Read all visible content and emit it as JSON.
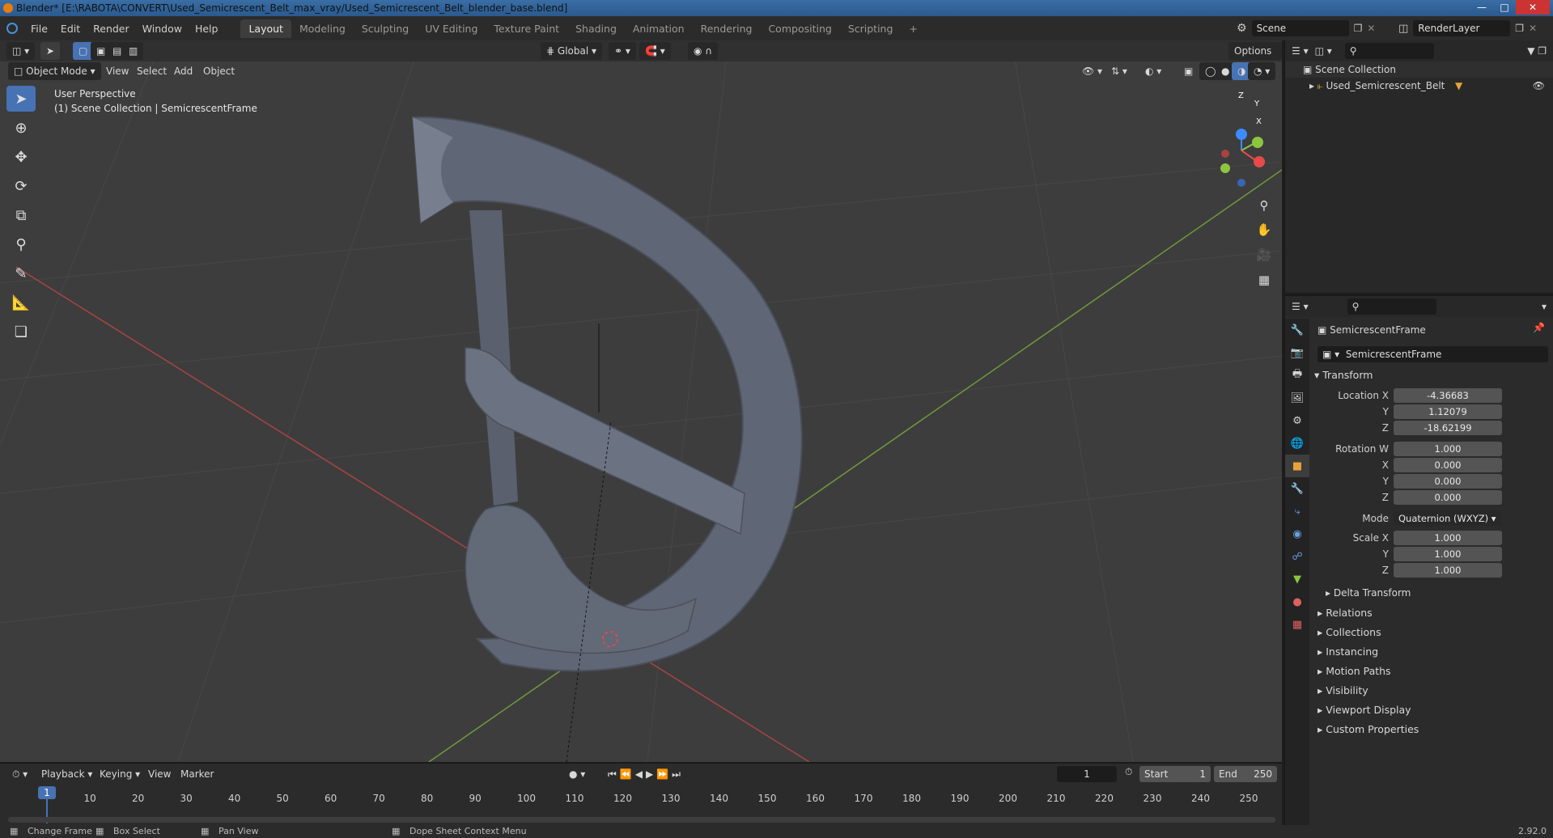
{
  "window": {
    "title": "Blender* [E:\\RABOTA\\CONVERT\\Used_Semicrescent_Belt_max_vray/Used_Semicrescent_Belt_blender_base.blend]"
  },
  "menubar": {
    "items": [
      "File",
      "Edit",
      "Render",
      "Window",
      "Help"
    ],
    "workspace_tabs": [
      "Layout",
      "Modeling",
      "Sculpting",
      "UV Editing",
      "Texture Paint",
      "Shading",
      "Animation",
      "Rendering",
      "Compositing",
      "Scripting"
    ],
    "active_tab": "Layout",
    "scene": "Scene",
    "view_layer": "RenderLayer"
  },
  "viewport": {
    "mode": "Object Mode",
    "menus": [
      "View",
      "Select",
      "Add",
      "Object"
    ],
    "orientation": "Global",
    "options_label": "Options",
    "perspective_label": "User Perspective",
    "collection_label": "(1) Scene Collection | SemicrescentFrame",
    "gizmo_axes": [
      "Z",
      "Y",
      "X"
    ]
  },
  "outliner": {
    "root": "Scene Collection",
    "items": [
      "Used_Semicrescent_Belt"
    ]
  },
  "properties": {
    "object_name": "SemicrescentFrame",
    "data_name": "SemicrescentFrame",
    "transform_label": "Transform",
    "location_label": "Location X",
    "location": {
      "x": "-4.36683",
      "y": "1.12079",
      "z": "-18.62199"
    },
    "rotation_label": "Rotation W",
    "rotation": {
      "w": "1.000",
      "x": "0.000",
      "y": "0.000",
      "z": "0.000"
    },
    "mode_label": "Mode",
    "mode_value": "Quaternion (WXYZ)",
    "scale_label": "Scale X",
    "scale": {
      "x": "1.000",
      "y": "1.000",
      "z": "1.000"
    },
    "axis_labels": {
      "x": "X",
      "y": "Y",
      "z": "Z"
    },
    "subpanels": [
      "Delta Transform"
    ],
    "panels": [
      "Relations",
      "Collections",
      "Instancing",
      "Motion Paths",
      "Visibility",
      "Viewport Display",
      "Custom Properties"
    ]
  },
  "timeline": {
    "menus": [
      "Playback",
      "Keying",
      "View",
      "Marker"
    ],
    "current_frame": "1",
    "start_label": "Start",
    "start": "1",
    "end_label": "End",
    "end": "250",
    "ticks": [
      "1",
      "10",
      "20",
      "30",
      "40",
      "50",
      "60",
      "70",
      "80",
      "90",
      "100",
      "110",
      "120",
      "130",
      "140",
      "150",
      "160",
      "170",
      "180",
      "190",
      "200",
      "210",
      "220",
      "230",
      "240",
      "250"
    ]
  },
  "statusbar": {
    "items": [
      "Change Frame",
      "Box Select",
      "Pan View",
      "Dope Sheet Context Menu"
    ],
    "version": "2.92.0"
  },
  "colors": {
    "accent": "#4772b3",
    "x_axis": "#e64a4a",
    "y_axis": "#8cc63f",
    "z_axis": "#3d8bff"
  }
}
